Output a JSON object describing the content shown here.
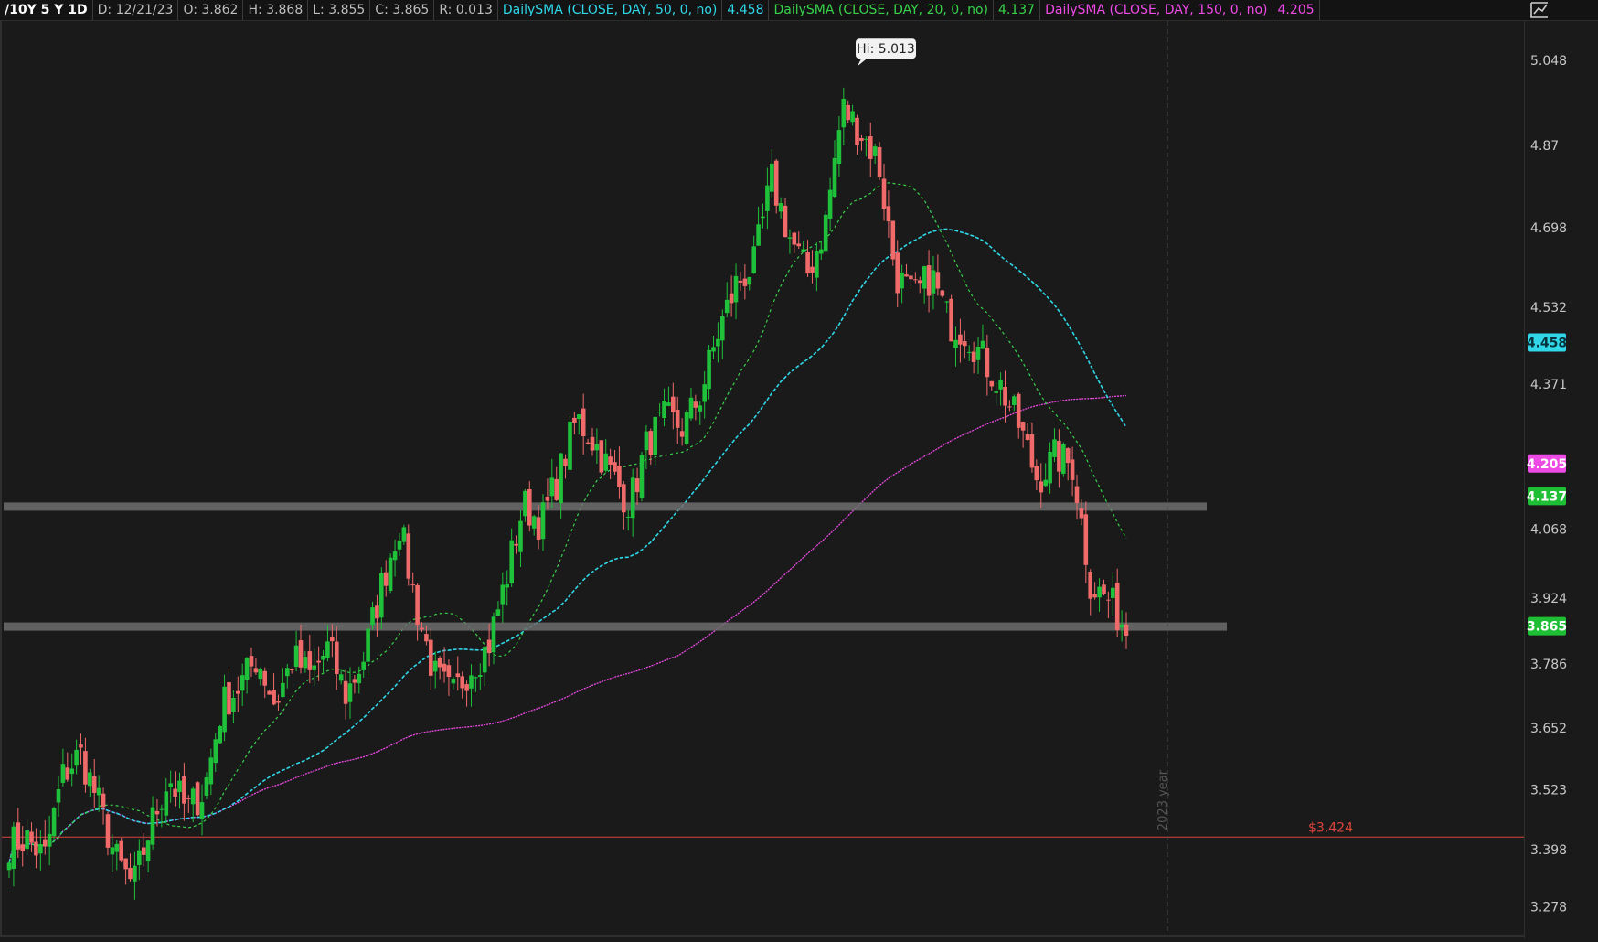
{
  "header": {
    "symbol": "/10Y 5 Y 1D",
    "date": "D: 12/21/23",
    "open": "O: 3.862",
    "high": "H: 3.868",
    "low": "L: 3.855",
    "close": "C: 3.865",
    "range": "R: 0.013",
    "sma50_label": "DailySMA (CLOSE, DAY, 50, 0, no)",
    "sma50_value": "4.458",
    "sma20_label": "DailySMA (CLOSE, DAY, 20, 0, no)",
    "sma20_value": "4.137",
    "sma150_label": "DailySMA (CLOSE, DAY, 150, 0, no)",
    "sma150_value": "4.205"
  },
  "corner_icon": "chart-settings-icon",
  "colors": {
    "background": "#1a1a1a",
    "up_candle": "#1fc13a",
    "down_candle": "#f06a6a",
    "sma50": "#2fd7e8",
    "sma20": "#38d24a",
    "sma150": "#ee4ae6",
    "support_band": "#6e6e6e",
    "alert_line": "#d9443c"
  },
  "chart_data": {
    "type": "candlestick",
    "symbol": "/10Y",
    "period": "5 Y",
    "aggregation": "1D",
    "ylim": [
      3.22,
      5.13
    ],
    "y_ticks": [
      3.278,
      3.398,
      3.523,
      3.652,
      3.786,
      3.924,
      4.068,
      4.371,
      4.532,
      4.698,
      4.87,
      5.048
    ],
    "y_tick_labels": [
      "3.278",
      "3.398",
      "3.523",
      "3.652",
      "3.786",
      "3.924",
      "4.068",
      "4.371",
      "4.532",
      "4.698",
      "4.87",
      "5.048"
    ],
    "high_marker": {
      "label": "Hi: 5.013",
      "value": 5.013
    },
    "support_levels": [
      4.116,
      3.865
    ],
    "alert": {
      "label": "$3.424",
      "value": 3.424
    },
    "year_marker": "2023 year",
    "series": [
      {
        "name": "DailySMA (CLOSE, DAY, 50, 0, no)",
        "last": 4.458
      },
      {
        "name": "DailySMA (CLOSE, DAY, 20, 0, no)",
        "last": 4.137
      },
      {
        "name": "DailySMA (CLOSE, DAY, 150, 0, no)",
        "last": 4.205
      }
    ],
    "badges": [
      {
        "label": "4.458",
        "value": 4.458,
        "color": "#2fd7e8"
      },
      {
        "label": "4.205",
        "value": 4.205,
        "color": "#ee4ae6"
      },
      {
        "label": "4.137",
        "value": 4.137,
        "color": "#1fbf35"
      },
      {
        "label": "3.865",
        "value": 3.865,
        "color": "#1fbf35"
      }
    ],
    "close_anchors": [
      3.41,
      3.42,
      3.38,
      3.55,
      3.6,
      3.5,
      3.38,
      3.32,
      3.45,
      3.55,
      3.48,
      3.52,
      3.7,
      3.74,
      3.8,
      3.7,
      3.8,
      3.76,
      3.82,
      3.72,
      3.8,
      3.95,
      4.08,
      3.9,
      3.76,
      3.72,
      3.78,
      3.82,
      3.96,
      4.12,
      4.08,
      4.18,
      4.3,
      4.25,
      4.18,
      4.12,
      4.25,
      4.3,
      4.28,
      4.35,
      4.48,
      4.58,
      4.62,
      4.8,
      4.68,
      4.6,
      4.7,
      4.95,
      4.9,
      4.84,
      4.6,
      4.55,
      4.6,
      4.5,
      4.48,
      4.42,
      4.36,
      4.28,
      4.17,
      4.22,
      4.2,
      3.95,
      3.92,
      3.86
    ]
  }
}
